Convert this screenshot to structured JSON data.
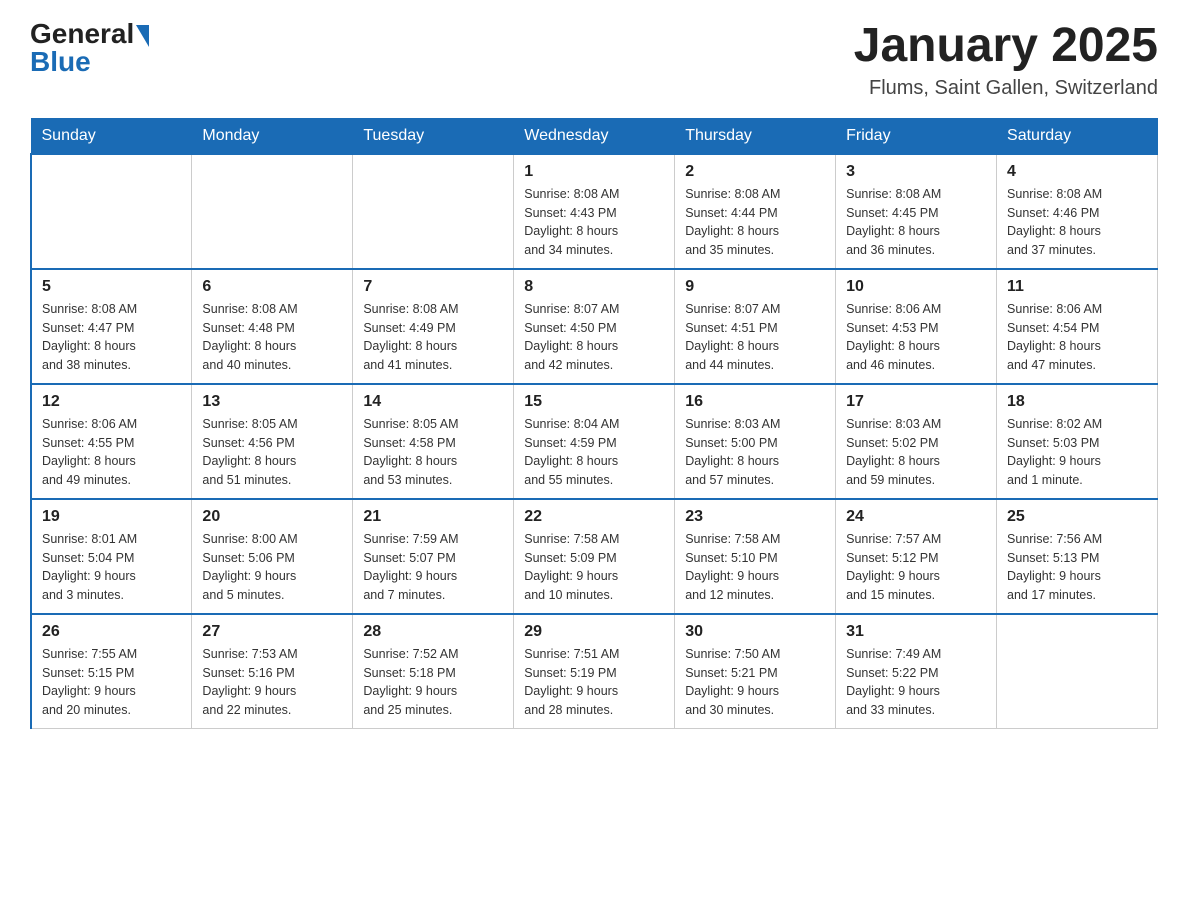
{
  "logo": {
    "general": "General",
    "blue": "Blue",
    "triangle": "▲"
  },
  "title": "January 2025",
  "subtitle": "Flums, Saint Gallen, Switzerland",
  "weekdays": [
    "Sunday",
    "Monday",
    "Tuesday",
    "Wednesday",
    "Thursday",
    "Friday",
    "Saturday"
  ],
  "weeks": [
    [
      {
        "day": "",
        "info": ""
      },
      {
        "day": "",
        "info": ""
      },
      {
        "day": "",
        "info": ""
      },
      {
        "day": "1",
        "info": "Sunrise: 8:08 AM\nSunset: 4:43 PM\nDaylight: 8 hours\nand 34 minutes."
      },
      {
        "day": "2",
        "info": "Sunrise: 8:08 AM\nSunset: 4:44 PM\nDaylight: 8 hours\nand 35 minutes."
      },
      {
        "day": "3",
        "info": "Sunrise: 8:08 AM\nSunset: 4:45 PM\nDaylight: 8 hours\nand 36 minutes."
      },
      {
        "day": "4",
        "info": "Sunrise: 8:08 AM\nSunset: 4:46 PM\nDaylight: 8 hours\nand 37 minutes."
      }
    ],
    [
      {
        "day": "5",
        "info": "Sunrise: 8:08 AM\nSunset: 4:47 PM\nDaylight: 8 hours\nand 38 minutes."
      },
      {
        "day": "6",
        "info": "Sunrise: 8:08 AM\nSunset: 4:48 PM\nDaylight: 8 hours\nand 40 minutes."
      },
      {
        "day": "7",
        "info": "Sunrise: 8:08 AM\nSunset: 4:49 PM\nDaylight: 8 hours\nand 41 minutes."
      },
      {
        "day": "8",
        "info": "Sunrise: 8:07 AM\nSunset: 4:50 PM\nDaylight: 8 hours\nand 42 minutes."
      },
      {
        "day": "9",
        "info": "Sunrise: 8:07 AM\nSunset: 4:51 PM\nDaylight: 8 hours\nand 44 minutes."
      },
      {
        "day": "10",
        "info": "Sunrise: 8:06 AM\nSunset: 4:53 PM\nDaylight: 8 hours\nand 46 minutes."
      },
      {
        "day": "11",
        "info": "Sunrise: 8:06 AM\nSunset: 4:54 PM\nDaylight: 8 hours\nand 47 minutes."
      }
    ],
    [
      {
        "day": "12",
        "info": "Sunrise: 8:06 AM\nSunset: 4:55 PM\nDaylight: 8 hours\nand 49 minutes."
      },
      {
        "day": "13",
        "info": "Sunrise: 8:05 AM\nSunset: 4:56 PM\nDaylight: 8 hours\nand 51 minutes."
      },
      {
        "day": "14",
        "info": "Sunrise: 8:05 AM\nSunset: 4:58 PM\nDaylight: 8 hours\nand 53 minutes."
      },
      {
        "day": "15",
        "info": "Sunrise: 8:04 AM\nSunset: 4:59 PM\nDaylight: 8 hours\nand 55 minutes."
      },
      {
        "day": "16",
        "info": "Sunrise: 8:03 AM\nSunset: 5:00 PM\nDaylight: 8 hours\nand 57 minutes."
      },
      {
        "day": "17",
        "info": "Sunrise: 8:03 AM\nSunset: 5:02 PM\nDaylight: 8 hours\nand 59 minutes."
      },
      {
        "day": "18",
        "info": "Sunrise: 8:02 AM\nSunset: 5:03 PM\nDaylight: 9 hours\nand 1 minute."
      }
    ],
    [
      {
        "day": "19",
        "info": "Sunrise: 8:01 AM\nSunset: 5:04 PM\nDaylight: 9 hours\nand 3 minutes."
      },
      {
        "day": "20",
        "info": "Sunrise: 8:00 AM\nSunset: 5:06 PM\nDaylight: 9 hours\nand 5 minutes."
      },
      {
        "day": "21",
        "info": "Sunrise: 7:59 AM\nSunset: 5:07 PM\nDaylight: 9 hours\nand 7 minutes."
      },
      {
        "day": "22",
        "info": "Sunrise: 7:58 AM\nSunset: 5:09 PM\nDaylight: 9 hours\nand 10 minutes."
      },
      {
        "day": "23",
        "info": "Sunrise: 7:58 AM\nSunset: 5:10 PM\nDaylight: 9 hours\nand 12 minutes."
      },
      {
        "day": "24",
        "info": "Sunrise: 7:57 AM\nSunset: 5:12 PM\nDaylight: 9 hours\nand 15 minutes."
      },
      {
        "day": "25",
        "info": "Sunrise: 7:56 AM\nSunset: 5:13 PM\nDaylight: 9 hours\nand 17 minutes."
      }
    ],
    [
      {
        "day": "26",
        "info": "Sunrise: 7:55 AM\nSunset: 5:15 PM\nDaylight: 9 hours\nand 20 minutes."
      },
      {
        "day": "27",
        "info": "Sunrise: 7:53 AM\nSunset: 5:16 PM\nDaylight: 9 hours\nand 22 minutes."
      },
      {
        "day": "28",
        "info": "Sunrise: 7:52 AM\nSunset: 5:18 PM\nDaylight: 9 hours\nand 25 minutes."
      },
      {
        "day": "29",
        "info": "Sunrise: 7:51 AM\nSunset: 5:19 PM\nDaylight: 9 hours\nand 28 minutes."
      },
      {
        "day": "30",
        "info": "Sunrise: 7:50 AM\nSunset: 5:21 PM\nDaylight: 9 hours\nand 30 minutes."
      },
      {
        "day": "31",
        "info": "Sunrise: 7:49 AM\nSunset: 5:22 PM\nDaylight: 9 hours\nand 33 minutes."
      },
      {
        "day": "",
        "info": ""
      }
    ]
  ]
}
